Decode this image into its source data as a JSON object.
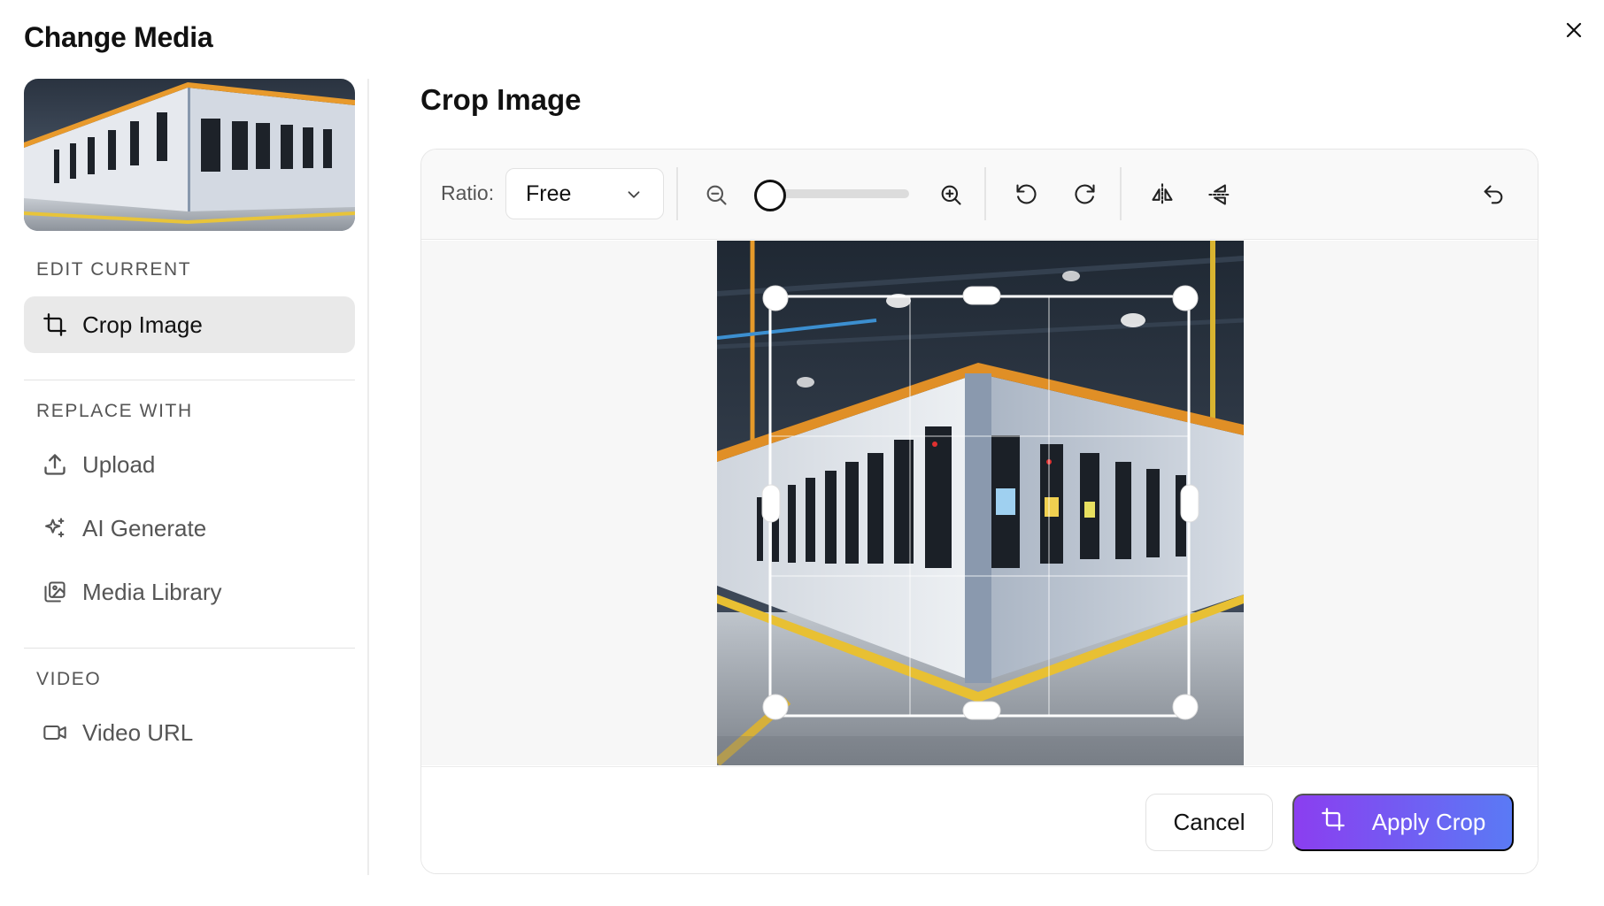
{
  "modal": {
    "title": "Change Media",
    "close_icon": "close-icon"
  },
  "sidebar": {
    "sections": [
      {
        "label": "EDIT CURRENT",
        "items": [
          {
            "label": "Crop Image",
            "icon": "crop-icon",
            "active": true
          }
        ]
      },
      {
        "label": "REPLACE WITH",
        "items": [
          {
            "label": "Upload",
            "icon": "upload-icon",
            "active": false
          },
          {
            "label": "AI Generate",
            "icon": "sparkles-icon",
            "active": false
          },
          {
            "label": "Media Library",
            "icon": "image-library-icon",
            "active": false
          }
        ]
      },
      {
        "label": "VIDEO",
        "items": [
          {
            "label": "Video URL",
            "icon": "video-icon",
            "active": false
          }
        ]
      }
    ]
  },
  "main": {
    "title": "Crop Image",
    "toolbar": {
      "ratio_label": "Ratio:",
      "ratio_value": "Free",
      "zoom_level": 0
    },
    "footer": {
      "cancel_label": "Cancel",
      "apply_label": "Apply Crop"
    }
  },
  "colors": {
    "accent_start": "#8b3ef0",
    "accent_end": "#5a7af5",
    "active_bg": "#e9e9e9"
  }
}
